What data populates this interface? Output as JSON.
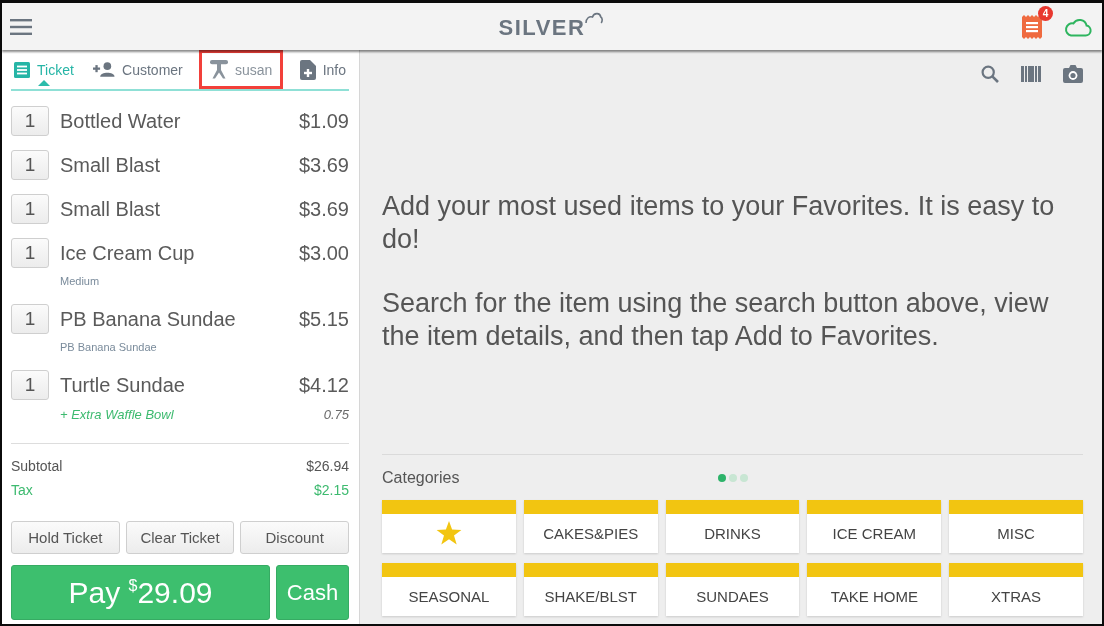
{
  "top_bar": {
    "logo": "SILVER",
    "notification_count": "4"
  },
  "tabs": [
    {
      "kind": "ticket",
      "label": "Ticket",
      "selected": true,
      "highlighted": false
    },
    {
      "kind": "customer",
      "label": "Customer",
      "selected": false,
      "highlighted": false
    },
    {
      "kind": "server",
      "label": "susan",
      "selected": false,
      "highlighted": true
    },
    {
      "kind": "info",
      "label": "Info",
      "selected": false,
      "highlighted": false
    }
  ],
  "ticket": {
    "items": [
      {
        "quantity": "1",
        "name": "Bottled Water",
        "price": "$1.09"
      },
      {
        "quantity": "1",
        "name": "Small Blast",
        "price": "$3.69"
      },
      {
        "quantity": "1",
        "name": "Small Blast",
        "price": "$3.69"
      },
      {
        "quantity": "1",
        "name": "Ice Cream Cup",
        "price": "$3.00",
        "modifiers": [
          {
            "kind": "note",
            "text": "Medium"
          }
        ]
      },
      {
        "quantity": "1",
        "name": "PB Banana Sundae",
        "price": "$5.15",
        "modifiers": [
          {
            "kind": "note",
            "text": "PB Banana Sundae"
          }
        ]
      },
      {
        "quantity": "1",
        "name": "Turtle Sundae",
        "price": "$4.12",
        "modifiers": [
          {
            "kind": "addon",
            "text": "+ Extra Waffle Bowl",
            "price": "0.75"
          }
        ]
      }
    ],
    "totals": [
      {
        "kind": "subtotal",
        "label": "Subtotal",
        "value": "$26.94"
      },
      {
        "kind": "tax",
        "label": "Tax",
        "value": "$2.15"
      }
    ],
    "actions": [
      "Hold Ticket",
      "Clear Ticket",
      "Discount"
    ],
    "pay": {
      "label": "Pay",
      "currency": "$",
      "amount": "29.09"
    },
    "cash_button": "Cash"
  },
  "favorites_hint": [
    "Add your most used items to your Favorites. It is easy to do!",
    "Search for the item using the search button above, view the item details, and then tap Add to Favorites."
  ],
  "categories": {
    "title": "Categories",
    "pages": [
      {
        "selected": true
      },
      {
        "selected": false
      },
      {
        "selected": false
      }
    ],
    "tiles": [
      {
        "kind": "favorites"
      },
      {
        "kind": "category",
        "label": "CAKES&PIES"
      },
      {
        "kind": "category",
        "label": "DRINKS"
      },
      {
        "kind": "category",
        "label": "ICE CREAM"
      },
      {
        "kind": "category",
        "label": "MISC"
      },
      {
        "kind": "category",
        "label": "SEASONAL"
      },
      {
        "kind": "category",
        "label": "SHAKE/BLST"
      },
      {
        "kind": "category",
        "label": "SUNDAES"
      },
      {
        "kind": "category",
        "label": "TAKE HOME"
      },
      {
        "kind": "category",
        "label": "XTRAS"
      }
    ]
  }
}
